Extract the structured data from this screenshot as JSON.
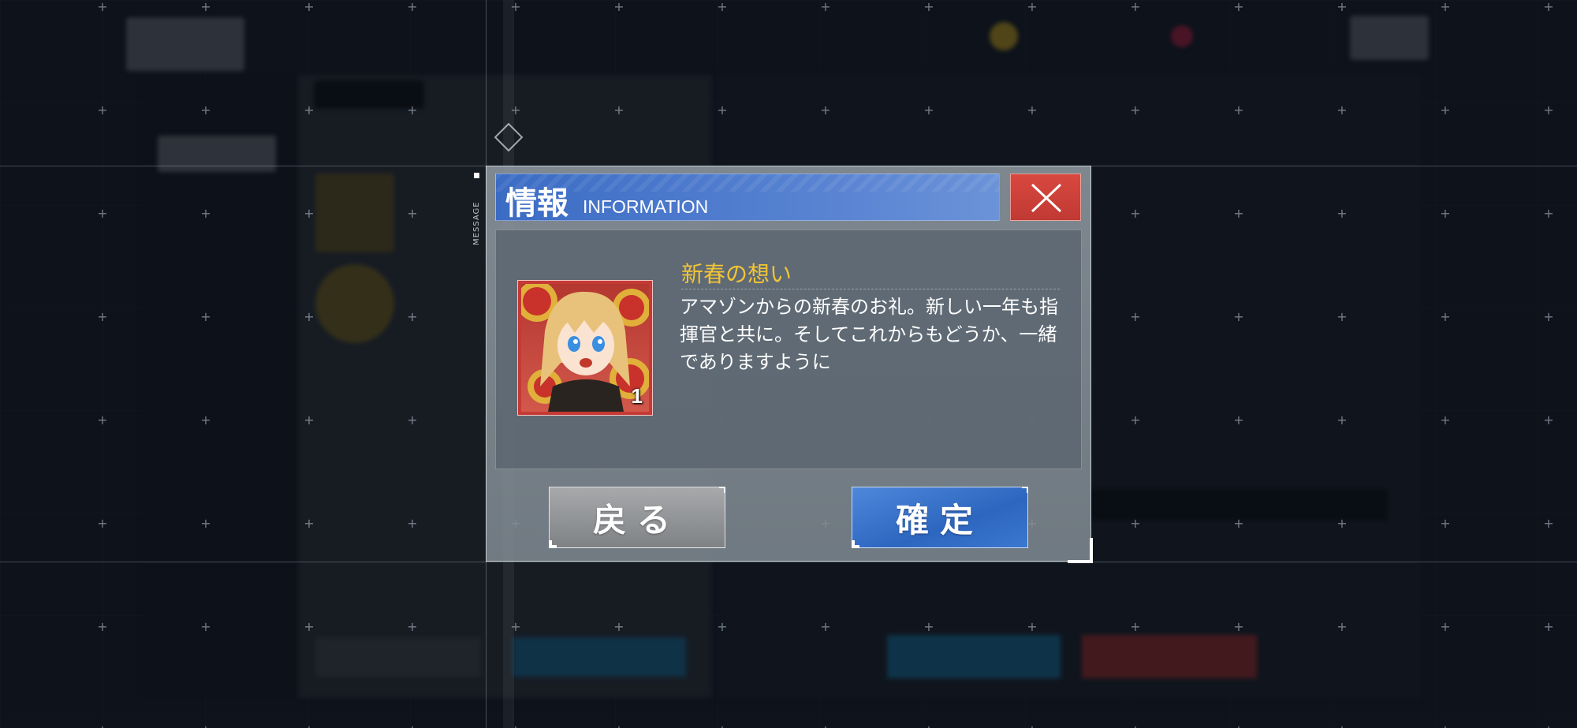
{
  "dialog": {
    "side_label": "MESSAGE",
    "title_jp": "情報",
    "title_en": "INFORMATION",
    "close_icon": "close-icon",
    "item": {
      "name": "新春の想い",
      "count": "1",
      "description": "アマゾンからの新春のお礼。新しい一年も指揮官と共に。そしてこれからもどうか、一緒でありますように",
      "icon": "character-portrait-icon"
    },
    "buttons": {
      "back_label": "戻る",
      "confirm_label": "確定"
    }
  },
  "colors": {
    "title_bar": "#3b6cc4",
    "close_button": "#d8483f",
    "confirm_button": "#2d66bf",
    "back_button": "#8f9295",
    "item_name": "#f2c535",
    "item_frame": "#c63a35"
  }
}
